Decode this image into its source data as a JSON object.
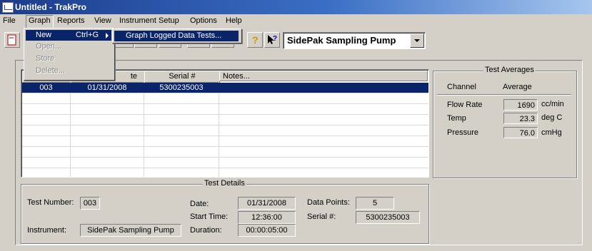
{
  "window": {
    "title": "Untitled - TrakPro"
  },
  "menubar": {
    "items": [
      "File",
      "Graph",
      "Reports",
      "View",
      "Instrument Setup",
      "Options",
      "Help"
    ]
  },
  "toolbar": {
    "instrument_selected": "SidePak Sampling Pump"
  },
  "graph_menu": {
    "items": [
      {
        "label": "New",
        "shortcut": "Ctrl+G"
      },
      {
        "label": "Open..."
      },
      {
        "label": "Store"
      },
      {
        "label": "Delete..."
      }
    ],
    "submenu": {
      "label": "Graph Logged Data Tests..."
    }
  },
  "test_list": {
    "columns": [
      "te",
      "Serial #",
      "Notes..."
    ],
    "rows": [
      {
        "test": "003",
        "date": "01/31/2008",
        "serial": "5300235003",
        "notes": ""
      }
    ]
  },
  "test_details": {
    "title": "Test Details",
    "test_number_label": "Test Number:",
    "test_number": "003",
    "instrument_label": "Instrument:",
    "instrument": "SidePak Sampling Pump",
    "date_label": "Date:",
    "date": "01/31/2008",
    "start_time_label": "Start Time:",
    "start_time": "12:36:00",
    "duration_label": "Duration:",
    "duration": "00:00:05:00",
    "data_points_label": "Data Points:",
    "data_points": "5",
    "serial_label": "Serial #:",
    "serial": "5300235003"
  },
  "test_averages": {
    "title": "Test Averages",
    "channel_header": "Channel",
    "average_header": "Average",
    "rows": [
      {
        "channel": "Flow Rate",
        "value": "1690",
        "unit": "cc/min"
      },
      {
        "channel": "Temp",
        "value": "23.3",
        "unit": "deg C"
      },
      {
        "channel": "Pressure",
        "value": "76.0",
        "unit": "cmHg"
      }
    ]
  },
  "colors": {
    "selection": "#0a246a",
    "titlebar_start": "#1c3c8c",
    "face": "#d4d0c8"
  }
}
